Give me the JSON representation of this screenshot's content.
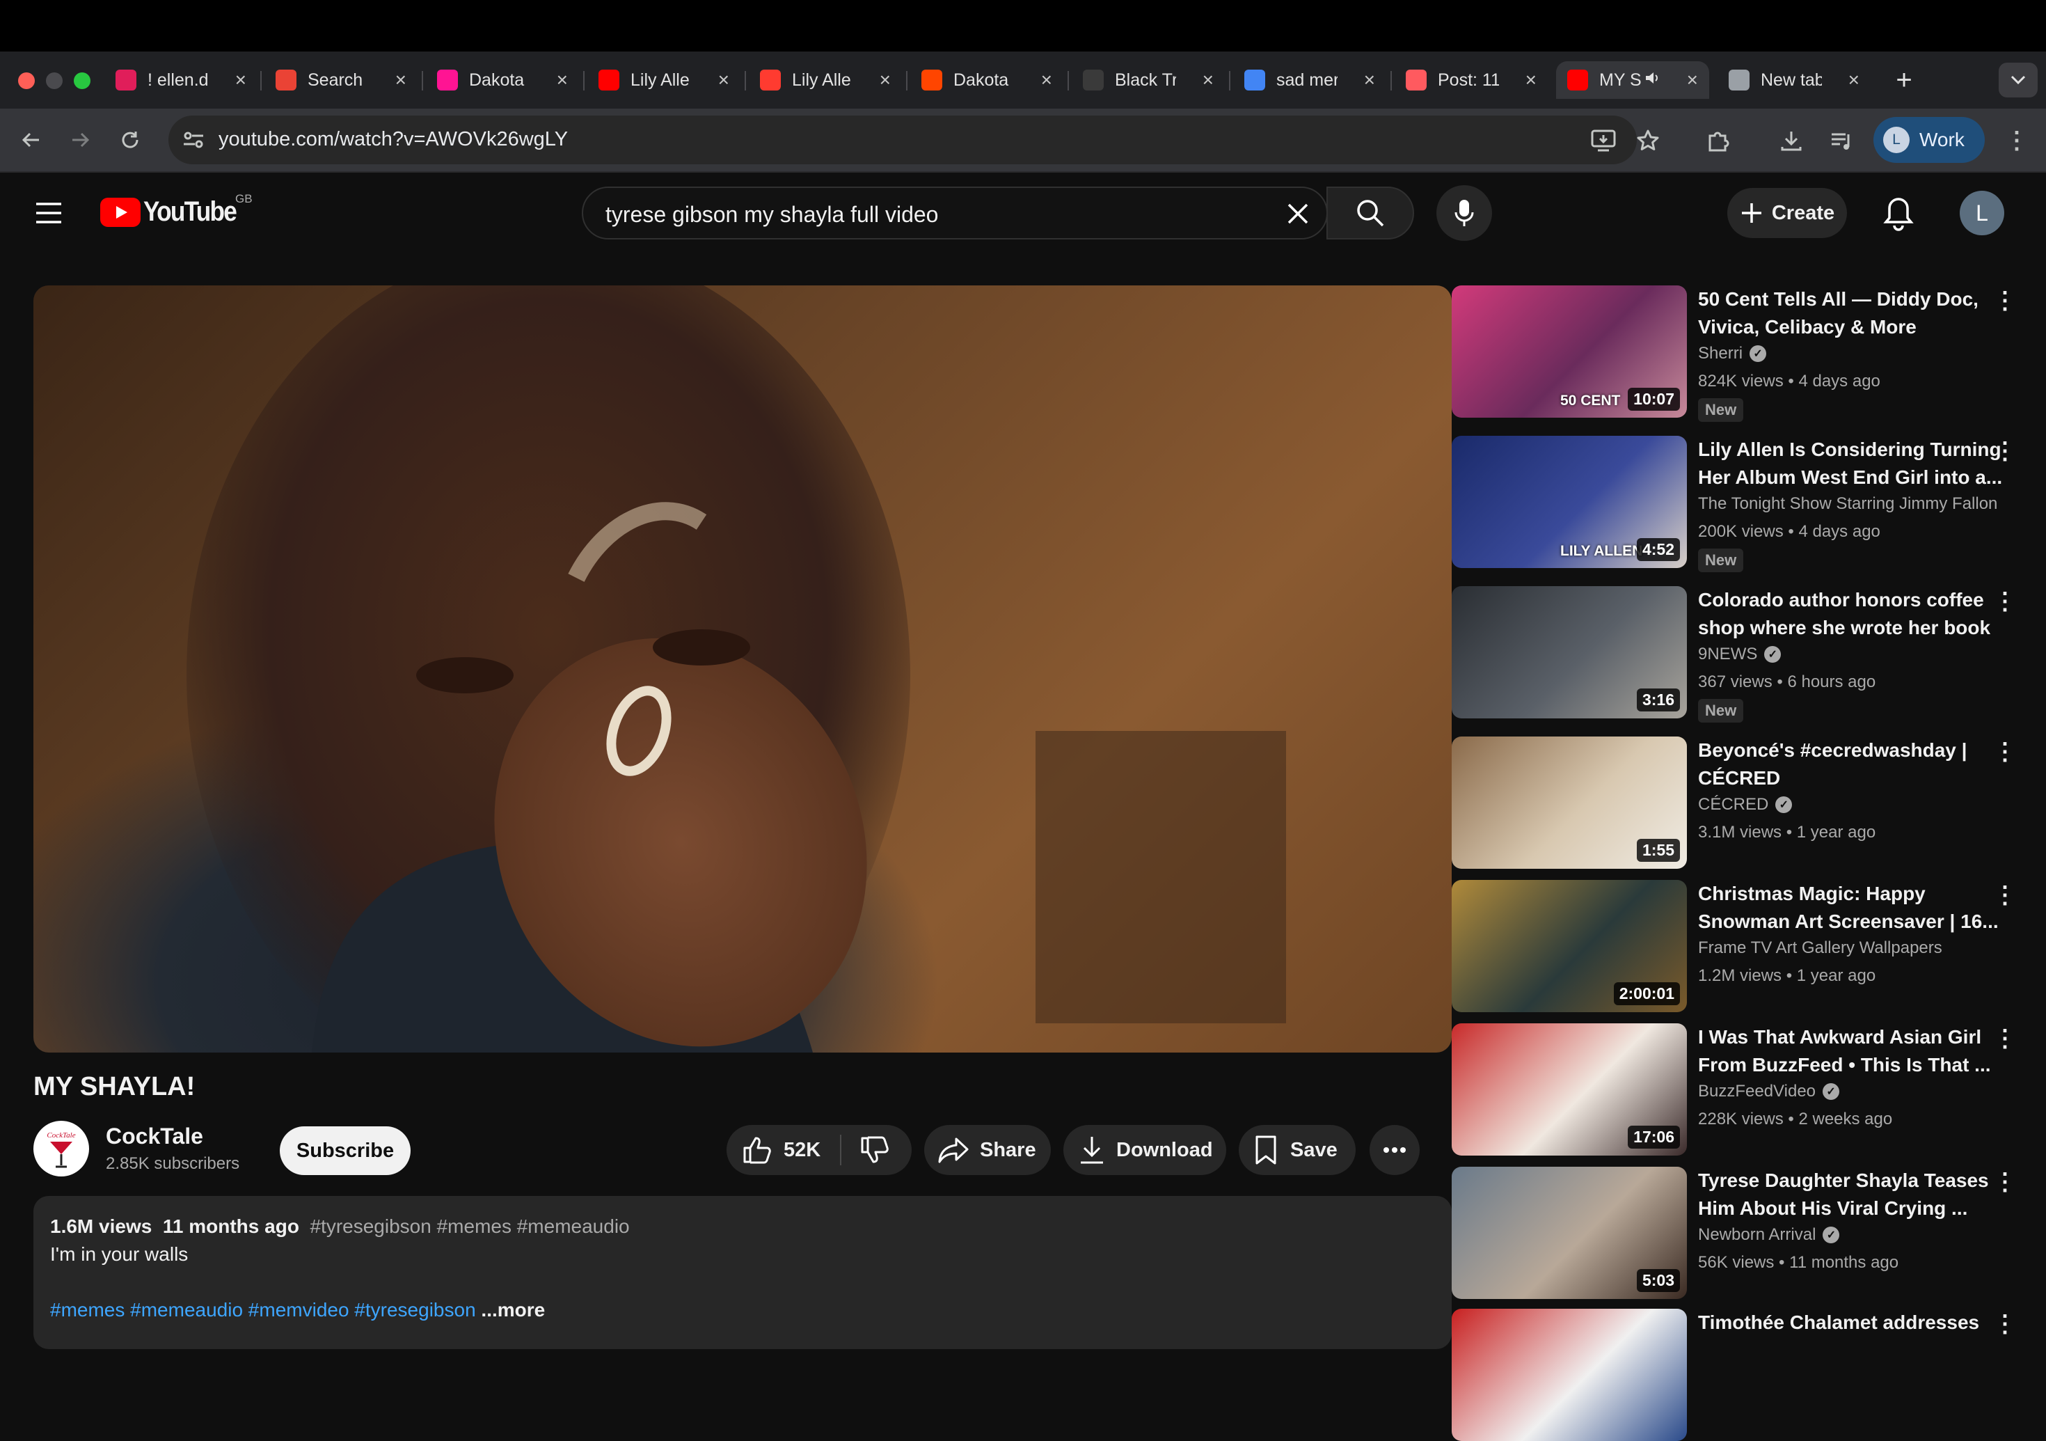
{
  "browser": {
    "tabs": [
      {
        "title": "! ellen.d",
        "icon": "slack-icon",
        "color": "#e01e5a"
      },
      {
        "title": "Search",
        "icon": "gmail-icon",
        "color": "#ea4335"
      },
      {
        "title": "Dakota",
        "icon": "pornhub-icon",
        "color": "#ff1493"
      },
      {
        "title": "Lily Alle",
        "icon": "youtube-icon",
        "color": "#ff0000"
      },
      {
        "title": "Lily Alle",
        "icon": "trending-icon",
        "color": "#ff3b30"
      },
      {
        "title": "Dakota",
        "icon": "reddit-icon",
        "color": "#ff4500"
      },
      {
        "title": "Black Tr",
        "icon": "openai-icon",
        "color": "#3a3a3a"
      },
      {
        "title": "sad mer",
        "icon": "docs-icon",
        "color": "#4285f4"
      },
      {
        "title": "Post: 11",
        "icon": "no-icon",
        "color": "#ff5a5f"
      },
      {
        "title": "MY S",
        "icon": "youtube-icon",
        "color": "#ff0000"
      },
      {
        "title": "New tab",
        "icon": "chrome-icon",
        "color": "#9aa0a6"
      }
    ],
    "url": "youtube.com/watch?v=AWOVk26wgLY",
    "profile_label": "Work",
    "profile_initial": "L"
  },
  "youtube": {
    "logo_text": "YouTube",
    "region": "GB",
    "search_query": "tyrese gibson my shayla full video",
    "create_label": "Create",
    "account_initial": "L"
  },
  "video": {
    "title": "MY SHAYLA!",
    "channel": "CockTale",
    "channel_logo_text": "CockTale",
    "subscribers": "2.85K subscribers",
    "subscribe_label": "Subscribe",
    "likes": "52K",
    "share_label": "Share",
    "download_label": "Download",
    "save_label": "Save",
    "views": "1.6M views",
    "age": "11 months ago",
    "hashtags_top": "#tyresegibson #memes #memeaudio",
    "description": "I'm in your walls",
    "hashtags_bottom": "#memes #memeaudio #memvideo #tyresegibson",
    "more_label": "...more"
  },
  "recommendations": [
    {
      "title": "50 Cent Tells All — Diddy Doc, Vivica, Celibacy & More",
      "channel": "Sherri",
      "verified": true,
      "stats": "824K views • 4 days ago",
      "duration": "10:07",
      "badge": "New",
      "thumb_text": "50 CENT",
      "colors": [
        "#d23a7a",
        "#6a2b5c",
        "#c78a9a"
      ]
    },
    {
      "title": "Lily Allen Is Considering Turning Her Album West End Girl into a...",
      "channel": "The Tonight Show Starring Jimmy Fallon",
      "verified": true,
      "stats": "200K views • 4 days ago",
      "duration": "4:52",
      "badge": "New",
      "thumb_text": "LILY ALLEN",
      "colors": [
        "#1a2a6a",
        "#3a4a9a",
        "#d8d0c8"
      ]
    },
    {
      "title": "Colorado author honors coffee shop where she wrote her book",
      "channel": "9NEWS",
      "verified": true,
      "stats": "367 views • 6 hours ago",
      "duration": "3:16",
      "badge": "New",
      "thumb_text": "",
      "colors": [
        "#2a2e33",
        "#5a6068",
        "#a8a49c"
      ]
    },
    {
      "title": "Beyoncé's #cecredwashday | CÉCRED",
      "channel": "CÉCRED",
      "verified": true,
      "stats": "3.1M views • 1 year ago",
      "duration": "1:55",
      "badge": "",
      "thumb_text": "",
      "colors": [
        "#8a6a4a",
        "#d8c8b0",
        "#f0ece4"
      ]
    },
    {
      "title": "Christmas Magic: Happy Snowman Art Screensaver | 16...",
      "channel": "Frame TV Art Gallery Wallpapers",
      "verified": false,
      "stats": "1.2M views • 1 year ago",
      "duration": "2:00:01",
      "badge": "",
      "thumb_text": "",
      "colors": [
        "#b08a3a",
        "#2a3a3a",
        "#7a5a2a"
      ]
    },
    {
      "title": "I Was That Awkward Asian Girl From BuzzFeed • This Is That ...",
      "channel": "BuzzFeedVideo",
      "verified": true,
      "stats": "228K views • 2 weeks ago",
      "duration": "17:06",
      "badge": "",
      "thumb_text": "",
      "colors": [
        "#c82a2a",
        "#f0e8e0",
        "#3a2a2a"
      ]
    },
    {
      "title": "Tyrese Daughter Shayla Teases Him About His Viral Crying ...",
      "channel": "Newborn Arrival",
      "verified": true,
      "stats": "56K views • 11 months ago",
      "duration": "5:03",
      "badge": "",
      "thumb_text": "",
      "colors": [
        "#6a7a8a",
        "#b8a898",
        "#3a2a22"
      ]
    },
    {
      "title": "Timothée Chalamet addresses",
      "channel": "",
      "verified": false,
      "stats": "",
      "duration": "",
      "badge": "",
      "thumb_text": "",
      "colors": [
        "#c82020",
        "#f0f0f0",
        "#2a4a8a"
      ]
    }
  ]
}
